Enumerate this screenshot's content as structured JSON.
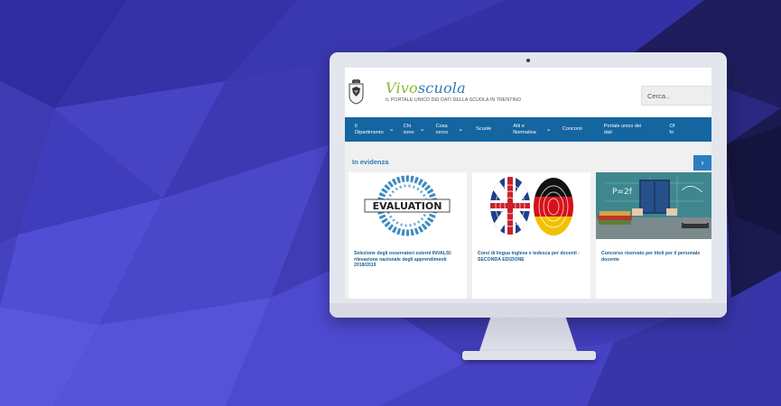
{
  "site": {
    "logo_part1": "Vivo",
    "logo_part2": "scuola",
    "tagline": "IL PORTALE UNICO DEI DATI DELLA SCUOLA IN TRENTINO",
    "search_placeholder": "Cerca.."
  },
  "nav": {
    "items": [
      {
        "label": "Il Dipartimento",
        "line1": "Il",
        "line2": "Dipartimento",
        "has_dropdown": true
      },
      {
        "label": "Chi sono",
        "line1": "Chi",
        "line2": "sono",
        "has_dropdown": true
      },
      {
        "label": "Cosa cerco",
        "line1": "Cosa",
        "line2": "cerco",
        "has_dropdown": true
      },
      {
        "label": "Scuole",
        "line1": "Scuole",
        "line2": "",
        "has_dropdown": false
      },
      {
        "label": "Atti e Normativa",
        "line1": "Atti e",
        "line2": "Normativa",
        "has_dropdown": true
      },
      {
        "label": "Concorsi",
        "line1": "Concorsi",
        "line2": "",
        "has_dropdown": false
      },
      {
        "label": "Portale unico dei dati",
        "line1": "Portale unico dei",
        "line2": "dati",
        "has_dropdown": false
      },
      {
        "label": "Of fo",
        "line1": "Of",
        "line2": "fo",
        "has_dropdown": false
      }
    ]
  },
  "featured": {
    "title": "In evidenza",
    "next_icon": "chevron-right-icon",
    "cards": [
      {
        "image_text": "EVALUATION",
        "title": "Selezione degli osservatori esterni INVALSI: rilevazione nazionale degli apprendimenti 2018/2019"
      },
      {
        "image": "uk-germany-fingerprints",
        "title": "Corsi di lingua inglese e tedesca per docenti - SECONDA EDIZIONE"
      },
      {
        "image_text": "P=2f",
        "title": "Concorso riservato per titoli per il personale docente"
      }
    ]
  },
  "colors": {
    "background": "#3f3cb5",
    "nav": "#1565a0",
    "accent": "#2f7cb5",
    "logo_green": "#8ab833"
  }
}
